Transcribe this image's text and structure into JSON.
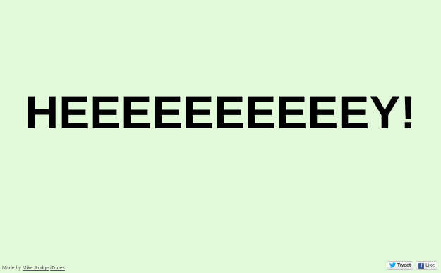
{
  "headline": "HEEEEEEEEEEY!",
  "footer": {
    "prefix": "Made by",
    "author_link": "Mike Rodge",
    "itunes_link": "iTunes"
  },
  "social": {
    "tweet_label": "Tweet",
    "like_label": "Like",
    "fb_icon_letter": "f"
  },
  "colors": {
    "background": "#e2fad9",
    "headline": "#000000",
    "twitter_blue": "#1da1f2",
    "facebook_blue": "#3b5998"
  }
}
